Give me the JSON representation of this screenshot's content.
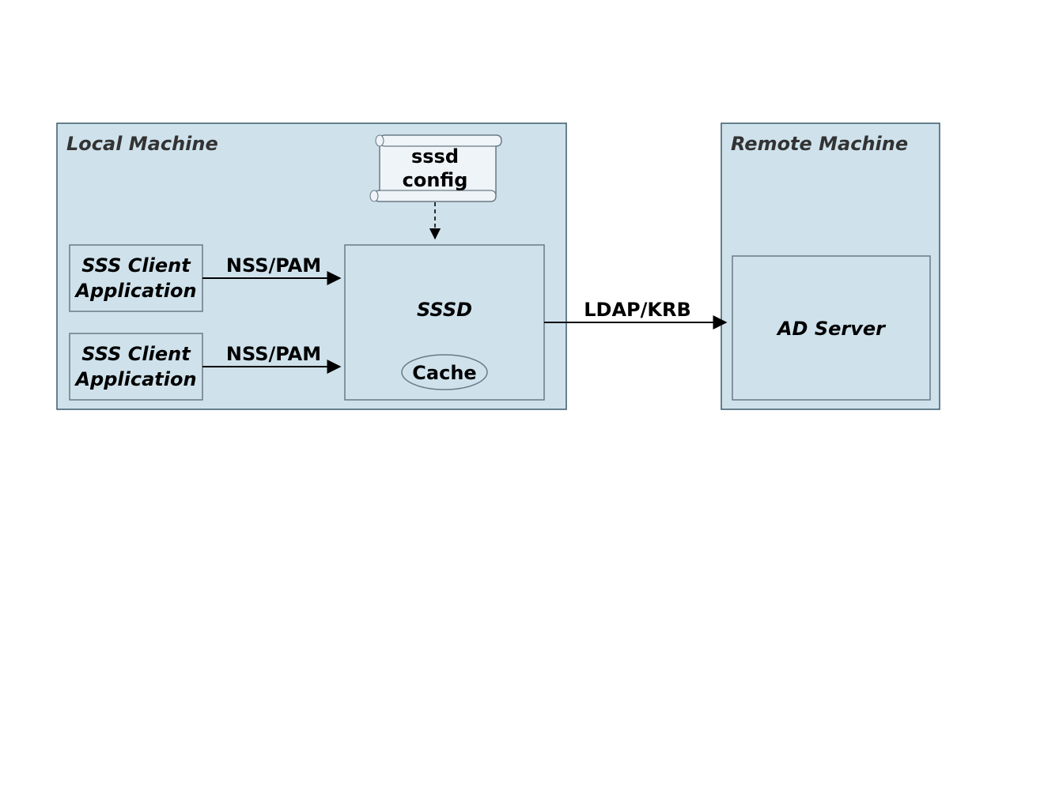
{
  "local_machine": {
    "title": "Local Machine"
  },
  "remote_machine": {
    "title": "Remote Machine"
  },
  "clients": [
    {
      "line1": "SSS Client",
      "line2": "Application"
    },
    {
      "line1": "SSS Client",
      "line2": "Application"
    }
  ],
  "sssd": {
    "label": "SSSD",
    "cache": "Cache",
    "config_line1": "sssd",
    "config_line2": "config"
  },
  "ad_server": {
    "label": "AD Server"
  },
  "edges": {
    "client1_to_sssd": "NSS/PAM",
    "client2_to_sssd": "NSS/PAM",
    "sssd_to_ad": "LDAP/KRB"
  },
  "colors": {
    "box_fill": "#cfe2ec",
    "box_stroke": "#3a5a6a",
    "inner_stroke": "#6a7a84"
  }
}
